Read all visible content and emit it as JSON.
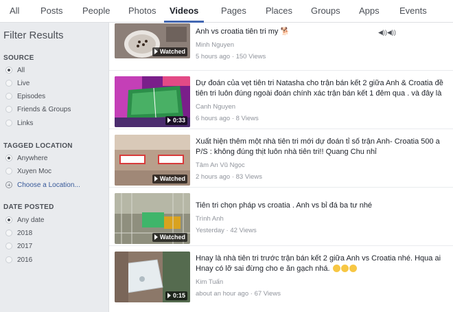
{
  "tabs": [
    {
      "label": "All",
      "active": false
    },
    {
      "label": "Posts",
      "active": false
    },
    {
      "label": "People",
      "active": false
    },
    {
      "label": "Photos",
      "active": false
    },
    {
      "label": "Videos",
      "active": true
    },
    {
      "label": "Pages",
      "active": false
    },
    {
      "label": "Places",
      "active": false
    },
    {
      "label": "Groups",
      "active": false
    },
    {
      "label": "Apps",
      "active": false
    },
    {
      "label": "Events",
      "active": false
    }
  ],
  "sidebar": {
    "title": "Filter Results",
    "source": {
      "label": "SOURCE",
      "options": [
        {
          "label": "All",
          "selected": true
        },
        {
          "label": "Live",
          "selected": false
        },
        {
          "label": "Episodes",
          "selected": false
        },
        {
          "label": "Friends & Groups",
          "selected": false
        },
        {
          "label": "Links",
          "selected": false
        }
      ]
    },
    "location": {
      "label": "TAGGED LOCATION",
      "options": [
        {
          "label": "Anywhere",
          "selected": true
        },
        {
          "label": "Xuyen Moc",
          "selected": false
        }
      ],
      "choose": "Choose a Location..."
    },
    "date": {
      "label": "DATE POSTED",
      "options": [
        {
          "label": "Any date",
          "selected": true
        },
        {
          "label": "2018",
          "selected": false
        },
        {
          "label": "2017",
          "selected": false
        },
        {
          "label": "2016",
          "selected": false
        }
      ]
    }
  },
  "results": [
    {
      "title": "Anh vs croatia tiên tri my",
      "title_line2": "",
      "author": "Minh Nguyen",
      "meta": "5 hours ago · 150 Views",
      "badge": "Watched",
      "thumb_icon": "bowl-icon"
    },
    {
      "title": "Dự đoán của vẹt tiên tri Natasha cho trận bán kết 2 giữa Anh & Croatia đề",
      "title_line2": "tiên tri luôn đúng ngoài đoán chính xác trận bán kết 1 đêm qua . và đây là",
      "author": "Canh Nguyen",
      "meta": "6 hours ago · 8 Views",
      "badge": "0:33",
      "thumb_icon": "pitch-icon"
    },
    {
      "title": "Xuất hiện thêm một nhà tiên tri mới dự đoán tỉ số trận Anh- Croatia 500 a",
      "title_line2": "P/S : không đúng thịt luôn nhà tiên tri!! Quang Chu nhỉ",
      "author": "Tâm An Vũ Ngọc",
      "meta": "2 hours ago · 83 Views",
      "badge": "Watched",
      "thumb_icon": "cards-icon"
    },
    {
      "title": "Tiên tri chọn pháp vs croatia . Anh vs bỉ đá ba tư nhé",
      "title_line2": "",
      "author": "Trình Anh",
      "meta": "Yesterday · 42 Views",
      "badge": "Watched",
      "thumb_icon": "cage-icon"
    },
    {
      "title": "Hnay là nhà tiên tri trước trận bán kết 2 giữa Anh vs Croatia nhé. Hqua ai",
      "title_line2": "Hnay có lỡ sai đừng cho e ăn gạch nhá.",
      "author": "Kim Tuấn",
      "meta": "about an hour ago · 67 Views",
      "badge": "0:15",
      "thumb_icon": "box-icon"
    }
  ]
}
